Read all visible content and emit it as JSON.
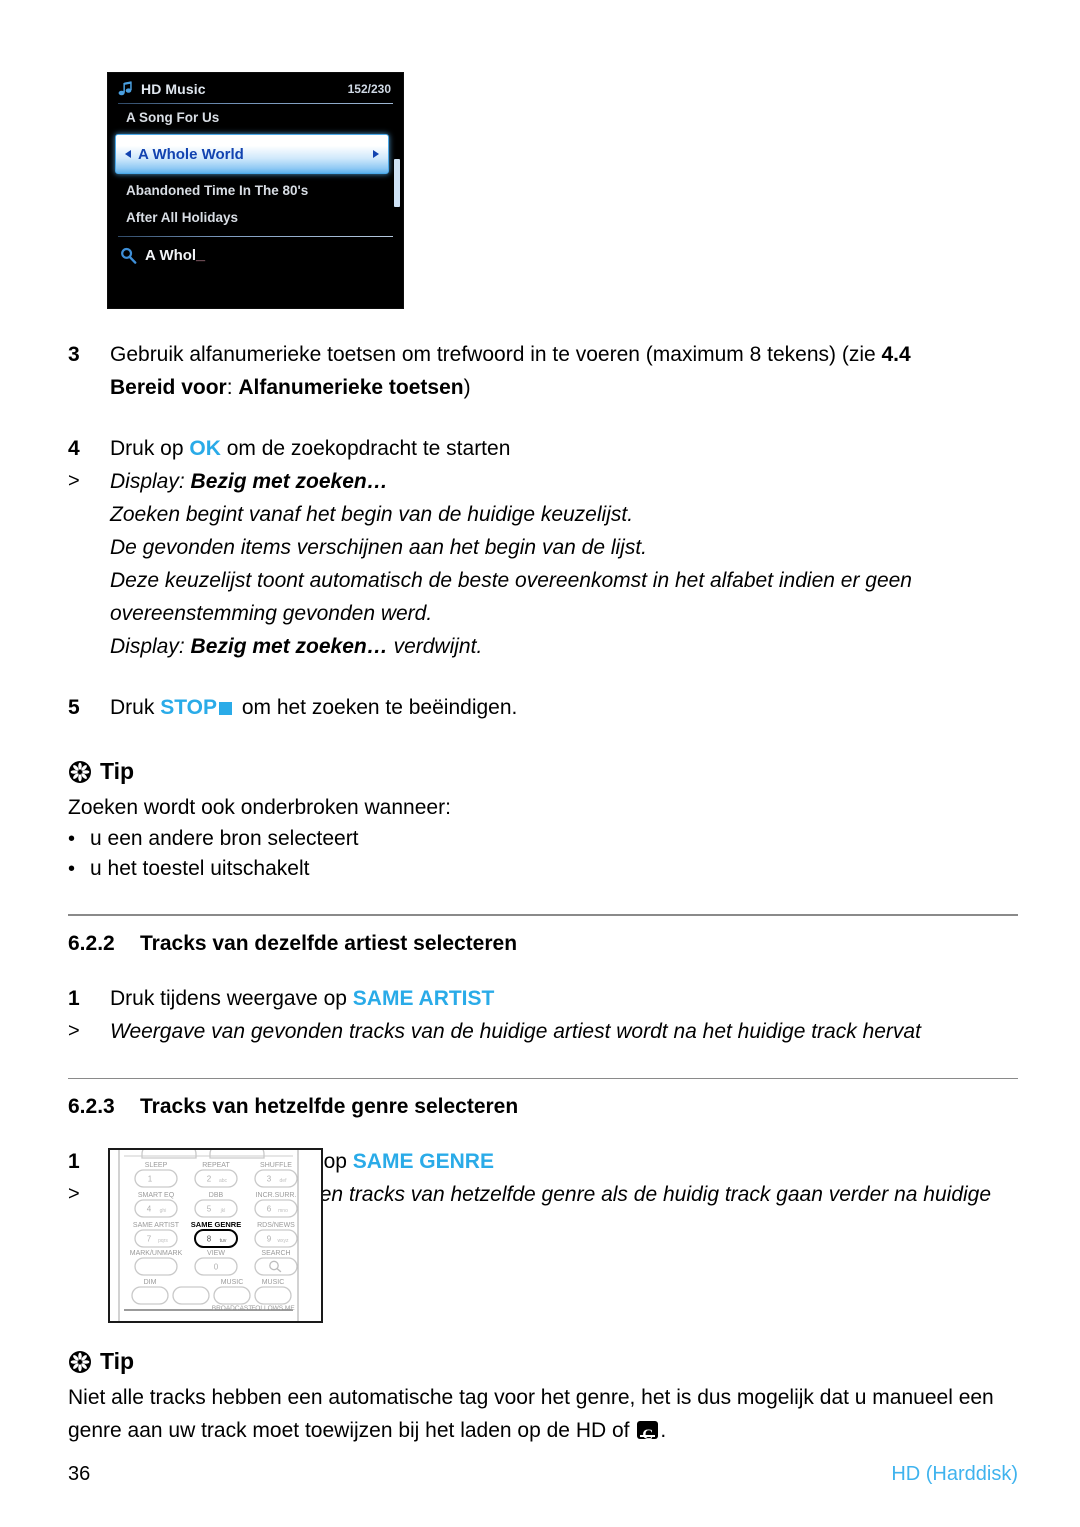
{
  "lcd": {
    "icon": "music-note-icon",
    "title": "HD Music",
    "count": "152/230",
    "items": [
      {
        "label": "A Song For Us",
        "selected": false
      },
      {
        "label": "A Whole World",
        "selected": true
      },
      {
        "label": "Abandoned Time In The 80's",
        "selected": false
      },
      {
        "label": "After All Holidays",
        "selected": false
      }
    ],
    "search": {
      "icon": "search-magnifier-icon",
      "value": "A Whol",
      "caret": "_"
    }
  },
  "steps": {
    "step3": {
      "number": "3",
      "line1_a": "Gebruik alfanumerieke toetsen om trefwoord in te voeren (maximum 8 tekens) (zie ",
      "line1_ref": "4.4",
      "line2_bold1": "Bereid voor",
      "line2_mid": ": ",
      "line2_bold2": "Alfanumerieke toetsen",
      "line2_end": ")"
    },
    "step4": {
      "number": "4",
      "pre": "Druk op ",
      "key": "OK",
      "post": " om de zoekopdracht te starten"
    },
    "result4": {
      "marker": ">",
      "label": "Display",
      "colon": ": ",
      "status": "Bezig met zoeken…",
      "detail1": "Zoeken begint vanaf het begin van de huidige keuzelijst.",
      "detail2": "De gevonden items verschijnen aan het begin van de lijst.",
      "detail3": "Deze keuzelijst toont automatisch de beste overeenkomst in het alfabet indien er geen",
      "detail4": "overeenstemming gevonden werd.",
      "detail5_label": "Display",
      "detail5_status": "Bezig met zoeken…",
      "detail5_end": " verdwijnt."
    },
    "step5": {
      "number": "5",
      "pre": "Druk ",
      "key": "STOP",
      "icon": "stop-square-icon",
      "post": " om het zoeken te beëindigen."
    }
  },
  "tip1": {
    "icon": "tip-asterisk-icon",
    "title": "Tip",
    "intro": "Zoeken wordt ook onderbroken wanneer:",
    "bullets": [
      "u een andere bron selecteert",
      "u het toestel uitschakelt"
    ]
  },
  "section622": {
    "number": "6.2.2",
    "title": "Tracks van dezelfde artiest selecteren",
    "step": {
      "number": "1",
      "pre": "Druk tijdens weergave op ",
      "key": "SAME ARTIST"
    },
    "result": {
      "marker": ">",
      "text": "Weergave van gevonden tracks van de huidige artiest wordt na het huidige track hervat"
    }
  },
  "section623": {
    "number": "6.2.3",
    "title": "Tracks van hetzelfde genre selecteren",
    "step": {
      "number": "1",
      "pre": "Druk tijdens weergave op ",
      "key": "SAME GENRE"
    },
    "result": {
      "marker": ">",
      "text": "Weergave van gevonden tracks van hetzelfde genre als de huidig track gaan verder na huidige track."
    }
  },
  "remote": {
    "name": "remote-control-diagram",
    "highlighted_button": "SAME GENRE",
    "buttons": [
      {
        "label": "SLEEP",
        "digit": "1",
        "letters": "",
        "row": 0,
        "col": 0,
        "highlight": false
      },
      {
        "label": "REPEAT",
        "digit": "2",
        "letters": "abc",
        "row": 0,
        "col": 1,
        "highlight": false
      },
      {
        "label": "SHUFFLE",
        "digit": "3",
        "letters": "def",
        "row": 0,
        "col": 2,
        "highlight": false
      },
      {
        "label": "SMART EQ",
        "digit": "4",
        "letters": "ghi",
        "row": 1,
        "col": 0,
        "highlight": false
      },
      {
        "label": "DBB",
        "digit": "5",
        "letters": "jkl",
        "row": 1,
        "col": 1,
        "highlight": false
      },
      {
        "label": "INCR.SURR.",
        "digit": "6",
        "letters": "mno",
        "row": 1,
        "col": 2,
        "highlight": false
      },
      {
        "label": "SAME ARTIST",
        "digit": "7",
        "letters": "pqrs",
        "row": 2,
        "col": 0,
        "highlight": false
      },
      {
        "label": "SAME GENRE",
        "digit": "8",
        "letters": "tuv",
        "row": 2,
        "col": 1,
        "highlight": true
      },
      {
        "label": "RDS/NEWS",
        "digit": "9",
        "letters": "wxyz",
        "row": 2,
        "col": 2,
        "highlight": false
      },
      {
        "label": "MARK/UNMARK",
        "digit": "",
        "letters": "",
        "row": 3,
        "col": 0,
        "highlight": false
      },
      {
        "label": "VIEW",
        "digit": "0",
        "letters": "",
        "row": 3,
        "col": 1,
        "highlight": false
      },
      {
        "label": "SEARCH",
        "digit": "",
        "letters": "",
        "row": 3,
        "col": 2,
        "highlight": false
      }
    ],
    "bottom_buttons": [
      {
        "label": "DIM",
        "sublabel": ""
      },
      {
        "label": "",
        "sublabel": ""
      },
      {
        "label": "MUSIC",
        "sublabel": "BROADCAST"
      },
      {
        "label": "MUSIC",
        "sublabel": "FOLLOWS ME"
      }
    ]
  },
  "tip2": {
    "icon": "tip-asterisk-icon",
    "title": "Tip",
    "line1": "Niet alle tracks hebben een automatische tag voor het genre, het is dus mogelijk dat u manueel een",
    "line2_a": "genre aan uw track moet toewijzen bij het laden op de HD of ",
    "line2_icon": "cd-disc-icon",
    "line2_b": "."
  },
  "footer": {
    "page": "36",
    "label": "HD (Harddisk)"
  },
  "colors": {
    "accent_cyan": "#2aabe8",
    "footer_cyan": "#3fb3ee",
    "lcd_selected_text": "#1243b0",
    "rule_gray": "#8a8a8a"
  }
}
